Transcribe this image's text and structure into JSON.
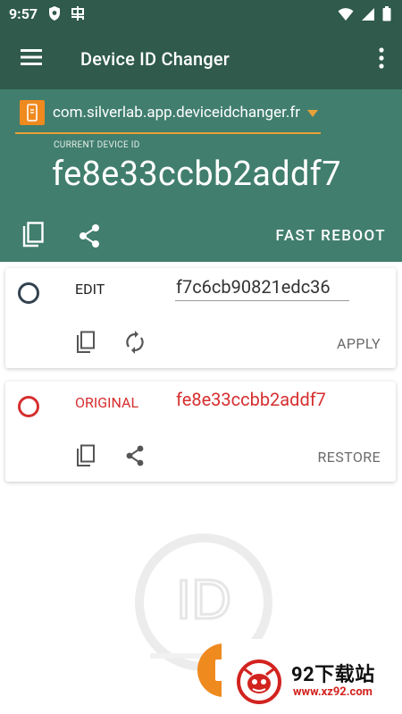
{
  "colors": {
    "appbar": "#2f5a4c",
    "header": "#417e6d",
    "accent": "#e8a13a",
    "fab": "#ef8a1f",
    "original_red": "#d62f2f",
    "edit_radio": "#33424f"
  },
  "status_bar": {
    "time": "9:57",
    "icons": [
      "shield-icon",
      "bug-icon",
      "wifi-icon",
      "signal-icon",
      "battery-icon"
    ]
  },
  "app_bar": {
    "title": "Device ID Changer",
    "icons": [
      "menu-icon",
      "more-vert-icon"
    ]
  },
  "header": {
    "package_name": "com.silverlab.app.deviceidchanger.fr",
    "current_label": "CURRENT DEVICE ID",
    "current_id": "fe8e33ccbb2addf7",
    "fast_reboot": "FAST REBOOT",
    "icons": [
      "copy-icon",
      "share-icon"
    ]
  },
  "edit_card": {
    "label": "EDIT",
    "value": "f7c6cb90821edc36",
    "action": "APPLY",
    "icons": [
      "copy-icon",
      "refresh-icon"
    ]
  },
  "original_card": {
    "label": "ORIGINAL",
    "value": "fe8e33ccbb2addf7",
    "action": "RESTORE",
    "icons": [
      "copy-icon",
      "share-icon"
    ]
  },
  "watermark": {
    "text": "ID"
  },
  "badge": {
    "title": "92下载站",
    "url": "www.xz92.com"
  }
}
